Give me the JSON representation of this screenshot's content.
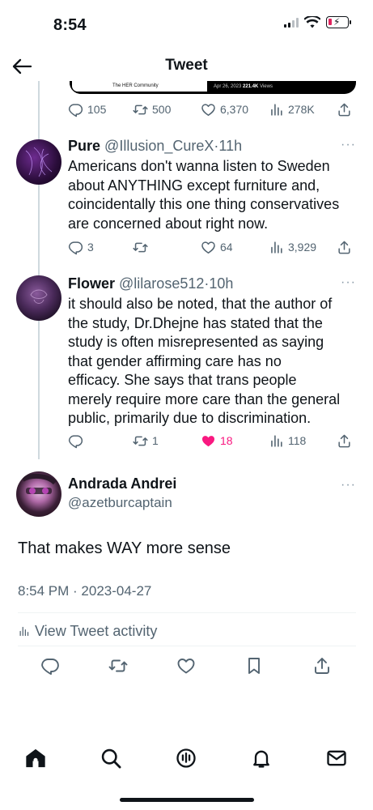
{
  "status_bar": {
    "time": "8:54"
  },
  "header": {
    "title": "Tweet"
  },
  "image_preview": {
    "caption": "The HER Community",
    "date": "Apr 26, 2023",
    "views_count": "221.4K",
    "views_label": "Views"
  },
  "top_tweet_stats": {
    "replies": "105",
    "retweets": "500",
    "likes": "6,370",
    "views": "278K"
  },
  "replies": [
    {
      "name": "Pure",
      "handle": "@Illusion_CureX",
      "time": "11h",
      "text_lines": [
        "Americans don't wanna listen to Sweden",
        "about ANYTHING except furniture and,",
        "coincidentally this one thing conservatives",
        "are concerned about right now."
      ],
      "stats": {
        "replies": "3",
        "retweets": "",
        "likes": "64",
        "views": "3,929"
      }
    },
    {
      "name": "Flower",
      "handle": "@lilarose512",
      "time": "10h",
      "text_lines": [
        "it should also be noted, that the author of",
        "the study, Dr.Dhejne has stated that the",
        "study is often misrepresented as saying",
        "that gender affirming care has no",
        "efficacy. She says that trans people",
        "merely require more care than the general",
        "public, primarily due to discrimination."
      ],
      "stats": {
        "replies": "",
        "retweets": "1",
        "likes": "18",
        "views": "118"
      }
    }
  ],
  "main_tweet": {
    "name": "Andrada Andrei",
    "handle": "@azetburcaptain",
    "text": "That makes WAY more sense",
    "timestamp": "8:54 PM · 2023-04-27",
    "activity_label": "View Tweet activity"
  },
  "colors": {
    "like_active": "#f91880",
    "muted": "#536471",
    "divider": "#eff3f4"
  },
  "icons": {
    "actions": [
      "reply-icon",
      "retweet-icon",
      "like-icon",
      "views-icon",
      "share-icon"
    ],
    "main_actions": [
      "reply-icon",
      "retweet-icon",
      "like-icon",
      "bookmark-icon",
      "share-icon"
    ],
    "tabs": [
      "home-icon",
      "search-icon",
      "spaces-icon",
      "notifications-icon",
      "messages-icon"
    ]
  }
}
